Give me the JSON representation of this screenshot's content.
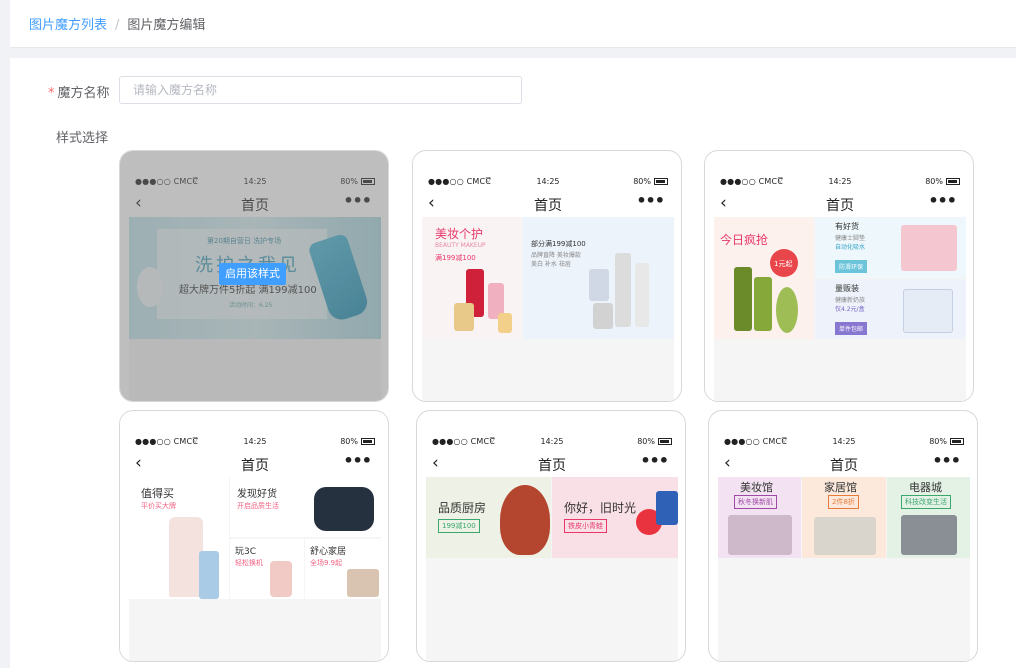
{
  "breadcrumb": {
    "parent": "图片魔方列表",
    "separator": "/",
    "current": "图片魔方编辑"
  },
  "form": {
    "name_required": "*",
    "name_label": "魔方名称",
    "name_placeholder": "请输入魔方名称",
    "name_value": "",
    "style_label": "样式选择"
  },
  "phone": {
    "carrier": "●●●○○ CMCC",
    "time": "14:25",
    "battery": "80%",
    "title": "首页",
    "back": "‹",
    "more": "•••"
  },
  "enable_button": "启用该样式",
  "cards": {
    "c1": {
      "small_top": "第20期自营日 洗护专场",
      "headline": "洗护之我见",
      "sub": "超大牌万件5折起 满199减100",
      "tiny": "活动时间：6.25"
    },
    "c2": {
      "left_title": "美妆个护",
      "left_en": "BEAUTY MAKEUP",
      "left_promo": "满199减100",
      "right_promo": "部分满199减100",
      "right_sub": "品牌直降 美妆爆款",
      "right_sub2": "美白 补水 祛痘"
    },
    "c3": {
      "left_title": "今日疯抢",
      "badge": "1元起",
      "rt_title": "有好货",
      "rt_sub": "健康士脚垫",
      "rt_sub2": "自动化吸水",
      "rt_tag": "防滑环保",
      "rb_title": "量贩装",
      "rb_sub": "健康新奶族",
      "rb_sub2": "仅4.2元/盒",
      "rb_tag": "单件包邮"
    },
    "c4": {
      "l_title": "值得买",
      "l_sub": "平价买大牌",
      "rt_title": "发现好货",
      "rt_sub": "开启品质生活",
      "b1_title": "玩3C",
      "b1_sub": "轻松换机",
      "b2_title": "舒心家居",
      "b2_sub": "全场9.9起"
    },
    "c5": {
      "l_title": "品质厨房",
      "l_tag": "199减100",
      "r_title": "你好，旧时光",
      "r_tag": "铁皮小青蛙"
    },
    "c6": {
      "a_title": "美妆馆",
      "a_tag": "秋冬换新肌",
      "b_title": "家居馆",
      "b_tag": "2件8折",
      "c_title": "电器城",
      "c_tag": "科技改变生活"
    }
  },
  "colors": {
    "link": "#409eff",
    "required": "#f56c6c",
    "accent_pink": "#e8386a",
    "accent_green": "#3aa76d"
  }
}
